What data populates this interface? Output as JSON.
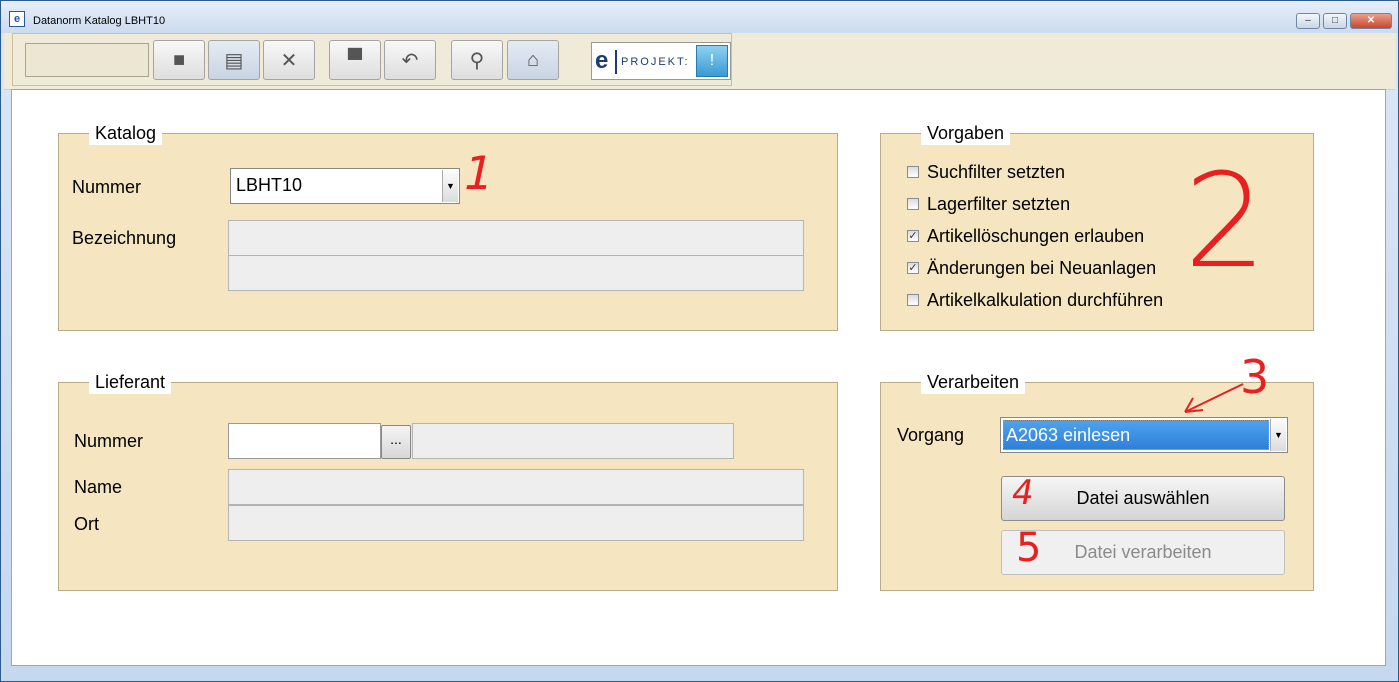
{
  "window": {
    "title": "Datanorm Katalog LBHT10",
    "app_icon": "e",
    "minimize": "–",
    "maximize": "□",
    "close": "✕"
  },
  "toolbar": {
    "buttons": [
      {
        "icon": "document-icon",
        "glyph": "■"
      },
      {
        "icon": "form-edit-icon",
        "glyph": "▤"
      },
      {
        "icon": "delete-x-icon",
        "glyph": "✕"
      },
      {
        "icon": "print-icon",
        "glyph": "▀"
      },
      {
        "icon": "undo-icon",
        "glyph": "↶"
      },
      {
        "icon": "key-icon",
        "glyph": "⚲"
      },
      {
        "icon": "home-refresh-icon",
        "glyph": "⌂"
      }
    ],
    "logo": {
      "letter": "e",
      "text": "PROJEKT:",
      "bubble": "!"
    }
  },
  "katalog": {
    "legend": "Katalog",
    "nummer_label": "Nummer",
    "nummer_value": "LBHT10",
    "bezeichnung_label": "Bezeichnung"
  },
  "lieferant": {
    "legend": "Lieferant",
    "nummer_label": "Nummer",
    "dots_label": "...",
    "name_label": "Name",
    "ort_label": "Ort"
  },
  "vorgaben": {
    "legend": "Vorgaben",
    "options": [
      {
        "label": "Suchfilter setzten",
        "checked": false
      },
      {
        "label": "Lagerfilter setzten",
        "checked": false
      },
      {
        "label": "Artikellöschungen erlauben",
        "checked": true
      },
      {
        "label": "Änderungen bei Neuanlagen",
        "checked": true
      },
      {
        "label": "Artikelkalkulation durchführen",
        "checked": false
      }
    ]
  },
  "verarbeiten": {
    "legend": "Verarbeiten",
    "vorgang_label": "Vorgang",
    "vorgang_value": "A2063 einlesen",
    "datei_auswaehlen": "Datei auswählen",
    "datei_verarbeiten": "Datei verarbeiten"
  },
  "annotations": {
    "a1": "1",
    "a2": "2",
    "a3": "3",
    "a4": "4",
    "a5": "5"
  },
  "colors": {
    "panel": "#f5e6c1",
    "toolbar": "#f0ebd8",
    "annotation": "#e82020",
    "selection": "#3388dd"
  }
}
